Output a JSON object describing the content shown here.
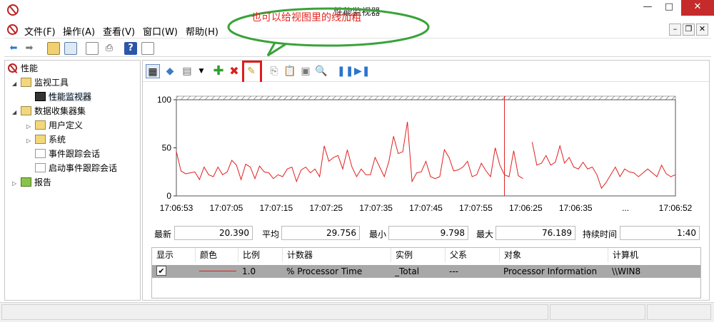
{
  "window": {
    "title": "性能监视器",
    "min_label": "—",
    "max_label": "□",
    "close_label": "✕"
  },
  "menu": [
    "文件(F)",
    "操作(A)",
    "查看(V)",
    "窗口(W)",
    "帮助(H)"
  ],
  "annotation": {
    "text": "也可以给视图里的线加粗",
    "color": "#e5261f",
    "ellipse_color": "#3aa23a"
  },
  "tree": [
    {
      "label": "性能",
      "level": 0,
      "arrow": ""
    },
    {
      "label": "监视工具",
      "level": 1,
      "arrow": "◢"
    },
    {
      "label": "性能监视器",
      "level": 2,
      "arrow": ""
    },
    {
      "label": "数据收集器集",
      "level": 1,
      "arrow": "◢"
    },
    {
      "label": "用户定义",
      "level": 2,
      "arrow": "▷"
    },
    {
      "label": "系统",
      "level": 2,
      "arrow": "▷"
    },
    {
      "label": "事件跟踪会话",
      "level": 2,
      "arrow": ""
    },
    {
      "label": "启动事件跟踪会话",
      "level": 2,
      "arrow": ""
    },
    {
      "label": "报告",
      "level": 1,
      "arrow": "▷"
    }
  ],
  "stats": {
    "last_label": "最新",
    "last_value": "20.390",
    "avg_label": "平均",
    "avg_value": "29.756",
    "min_label": "最小",
    "min_value": "9.798",
    "max_label": "最大",
    "max_value": "76.189",
    "dur_label": "持续时间",
    "dur_value": "1:40"
  },
  "counters": {
    "headers": [
      "显示",
      "颜色",
      "比例",
      "计数器",
      "实例",
      "父系",
      "对象",
      "计算机"
    ],
    "row": {
      "show": "✔",
      "scale": "1.0",
      "counter": "% Processor Time",
      "instance": "_Total",
      "parent": "---",
      "object": "Processor Information",
      "computer": "\\\\WIN8"
    }
  },
  "chart_data": {
    "type": "line",
    "ylim": [
      0,
      100
    ],
    "yticks": [
      "100",
      "50",
      "0"
    ],
    "xticks": [
      "17:06:53",
      "17:07:05",
      "17:07:15",
      "17:07:25",
      "17:07:35",
      "17:07:45",
      "17:07:55",
      "17:06:25",
      "17:06:35",
      "...",
      "17:06:52"
    ],
    "line_color": "#e02020",
    "cursor_index": 71,
    "series": [
      {
        "values": [
          46,
          26,
          23,
          24,
          25,
          17,
          30,
          22,
          20,
          30,
          22,
          25,
          37,
          32,
          17,
          33,
          30,
          18,
          31,
          25,
          24,
          18,
          22,
          20,
          28,
          30,
          15,
          27,
          30,
          24,
          28,
          20,
          52,
          36,
          40,
          42,
          28,
          48,
          30,
          20,
          28,
          22,
          22,
          40,
          30,
          20,
          36,
          62,
          44,
          46,
          77,
          15,
          24,
          25,
          36,
          20,
          18,
          20,
          48,
          40,
          26,
          27,
          30,
          36,
          20,
          22,
          34,
          26,
          20,
          50,
          32,
          22,
          20,
          47,
          21,
          18,
          null,
          56,
          32,
          34,
          42,
          32,
          35,
          52,
          34,
          40,
          30,
          28,
          35,
          28,
          30,
          22,
          8,
          14,
          22,
          30,
          20,
          28,
          25,
          24,
          20,
          24,
          28,
          24,
          20,
          32,
          23,
          20,
          22
        ]
      }
    ]
  }
}
